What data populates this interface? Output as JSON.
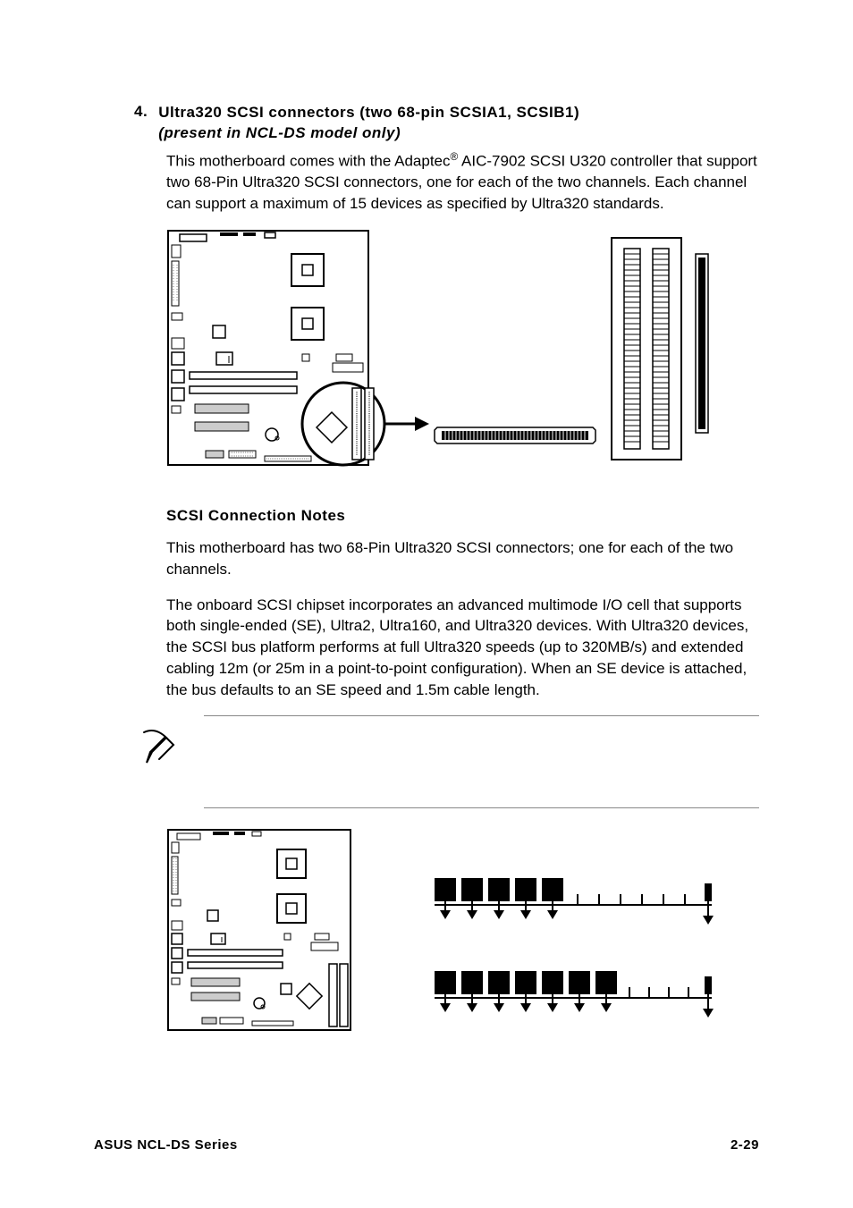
{
  "section": {
    "number": "4.",
    "title_line1": "Ultra320 SCSI connectors (two 68-pin SCSIA1, SCSIB1)",
    "title_line2": "(present in NCL-DS model only)"
  },
  "para1_a": "This motherboard comes with the Adaptec",
  "para1_sup": "®",
  "para1_b": " AIC-7902 SCSI U320 controller that support two 68-Pin Ultra320 SCSI connectors, one for each of the two channels. Each channel can support a maximum of 15 devices as specified by Ultra320 standards.",
  "subheading": "SCSI Connection Notes",
  "para2": "This motherboard has two 68-Pin Ultra320 SCSI connectors; one for each of the two channels.",
  "para3": "The onboard SCSI chipset incorporates an advanced multimode I/O cell that supports both single-ended (SE), Ultra2, Ultra160, and Ultra320 devices. With Ultra320 devices, the SCSI bus platform performs at full Ultra320 speeds (up to 320MB/s) and extended cabling 12m (or 25m in a point-to-point configuration). When an SE device is attached, the bus defaults to an SE speed and 1.5m cable length.",
  "footer": {
    "left": "ASUS NCL-DS Series",
    "right": "2-29"
  }
}
